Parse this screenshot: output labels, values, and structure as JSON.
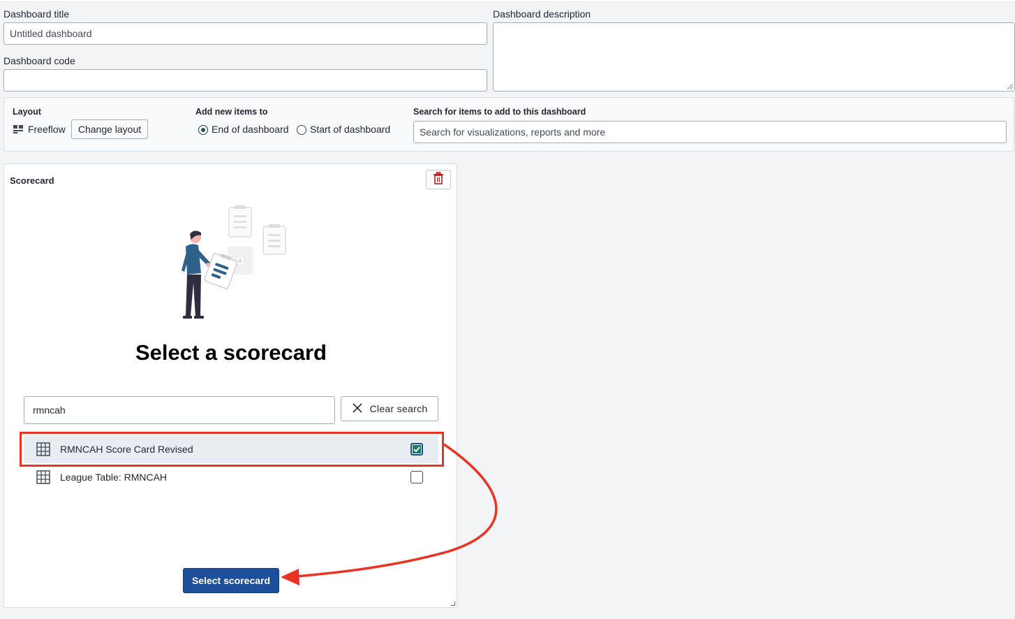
{
  "form": {
    "title_label": "Dashboard title",
    "title_placeholder": "Untitled dashboard",
    "description_label": "Dashboard description",
    "code_label": "Dashboard code"
  },
  "toolbar": {
    "layout_label": "Layout",
    "layout_value": "Freeflow",
    "change_layout": "Change layout",
    "add_items_label": "Add new items to",
    "radio_end": "End of dashboard",
    "radio_start": "Start of dashboard",
    "radio_selected": "End of dashboard",
    "search_label": "Search for items to add to this dashboard",
    "search_placeholder": "Search for visualizations, reports and more"
  },
  "card": {
    "title": "Scorecard",
    "heading": "Select a scorecard",
    "search_value": "rmncah",
    "clear_search": "Clear search",
    "items": [
      {
        "label": "RMNCAH Score Card Revised",
        "checked": true
      },
      {
        "label": "League Table: RMNCAH",
        "checked": false
      }
    ],
    "select_button": "Select scorecard"
  },
  "colors": {
    "primary": "#1d4f9a",
    "annotation": "#ea3323",
    "check": "#147e68",
    "delete": "#c01a1a"
  },
  "icons": [
    "layout-icon",
    "trash-icon",
    "clear-icon",
    "table-icon",
    "check-icon"
  ]
}
